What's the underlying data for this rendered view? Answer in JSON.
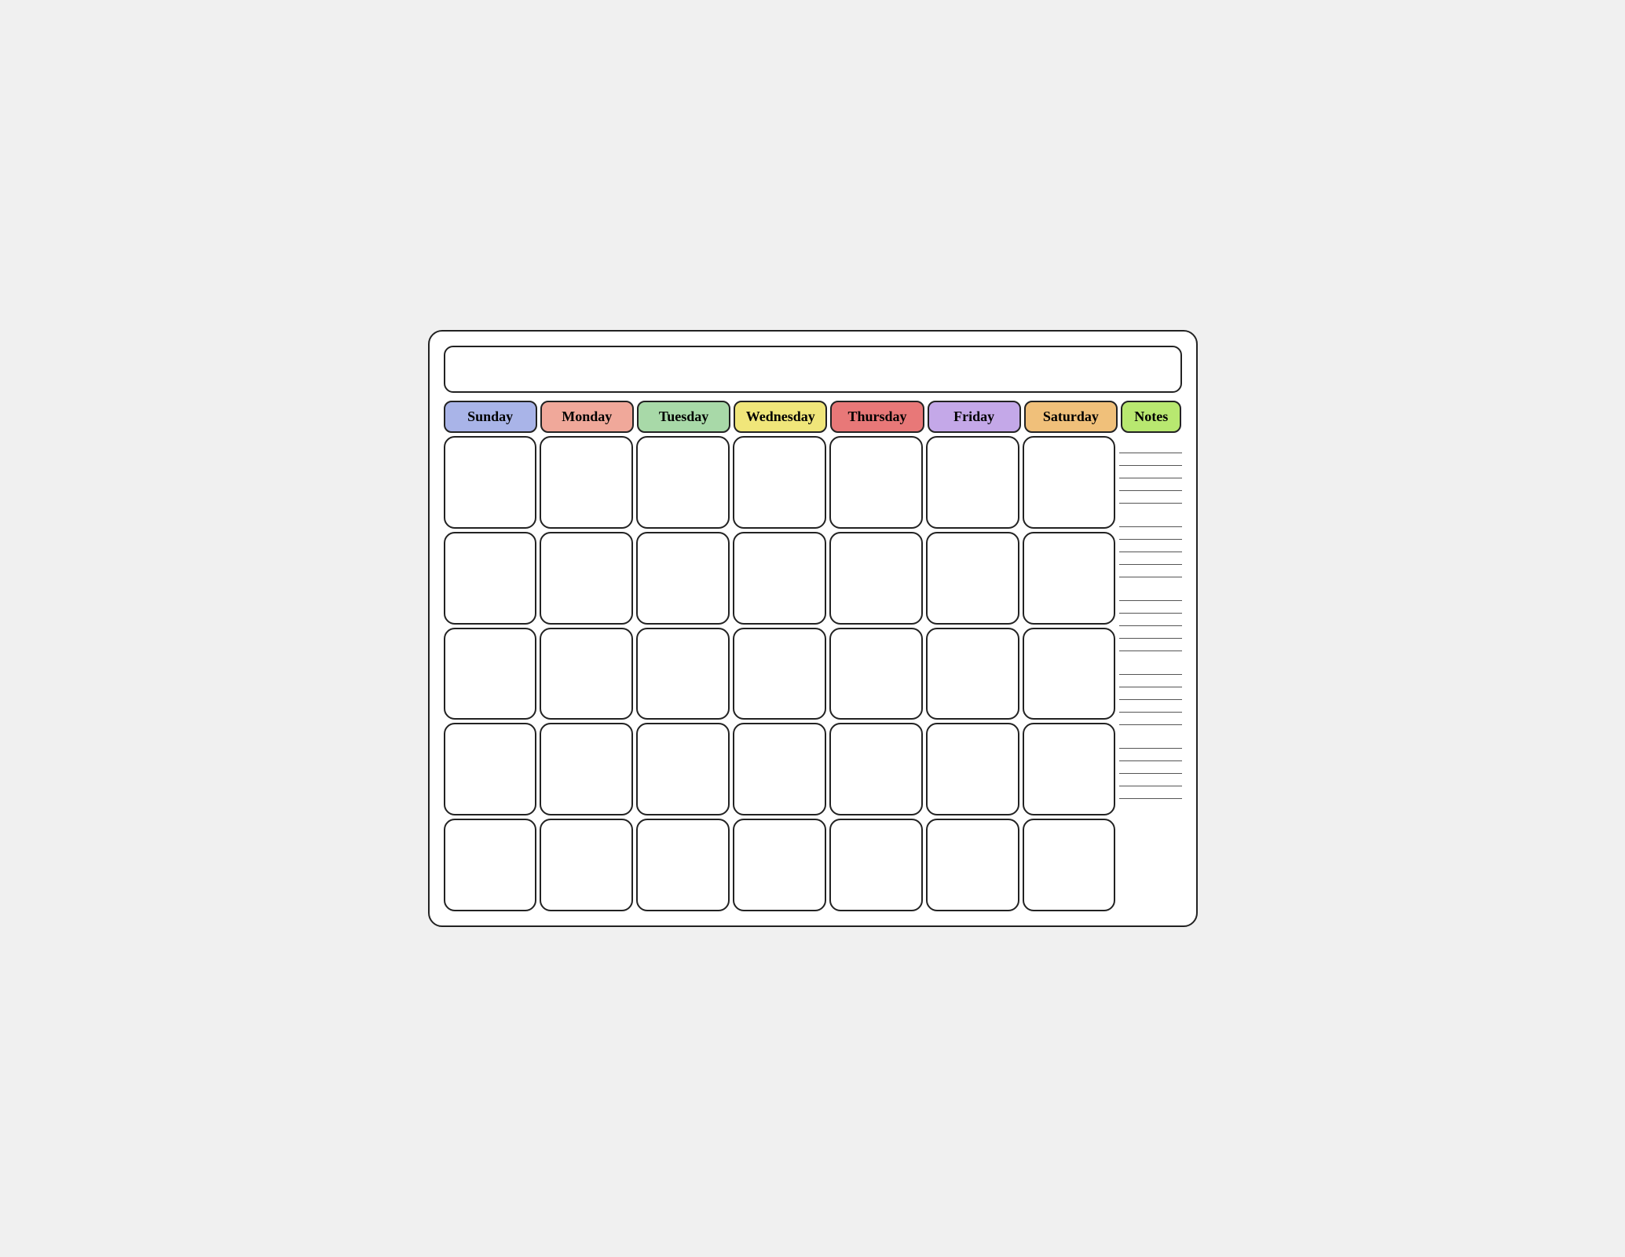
{
  "header": {
    "days": [
      {
        "label": "Sunday",
        "class": "sunday"
      },
      {
        "label": "Monday",
        "class": "monday"
      },
      {
        "label": "Tuesday",
        "class": "tuesday"
      },
      {
        "label": "Wednesday",
        "class": "wednesday"
      },
      {
        "label": "Thursday",
        "class": "thursday"
      },
      {
        "label": "Friday",
        "class": "friday"
      },
      {
        "label": "Saturday",
        "class": "saturday"
      },
      {
        "label": "Notes",
        "class": "notes"
      }
    ]
  },
  "calendar": {
    "rows": 5,
    "cols": 7
  },
  "notes": {
    "lines_per_group": 5,
    "groups": 5
  }
}
